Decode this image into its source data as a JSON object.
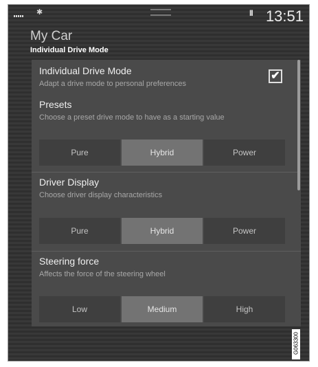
{
  "status": {
    "bluetooth_icon": "bluetooth-icon",
    "pause": "II",
    "time": "13:51"
  },
  "header": {
    "title": "My Car",
    "subtitle": "Individual Drive Mode"
  },
  "drive_mode": {
    "label": "Individual Drive Mode",
    "description": "Adapt a drive mode to personal preferences",
    "checked": true,
    "check_glyph": "✔"
  },
  "presets": {
    "label": "Presets",
    "description": "Choose a preset drive mode to have as a starting value",
    "options": [
      "Pure",
      "Hybrid",
      "Power"
    ],
    "selected": "Hybrid"
  },
  "driver_display": {
    "label": "Driver Display",
    "description": "Choose driver display characteristics",
    "options": [
      "Pure",
      "Hybrid",
      "Power"
    ],
    "selected": "Hybrid"
  },
  "steering": {
    "label": "Steering force",
    "description": "Affects the force of the steering wheel",
    "options": [
      "Low",
      "Medium",
      "High"
    ],
    "selected": "Medium"
  },
  "image_code": "G063300"
}
